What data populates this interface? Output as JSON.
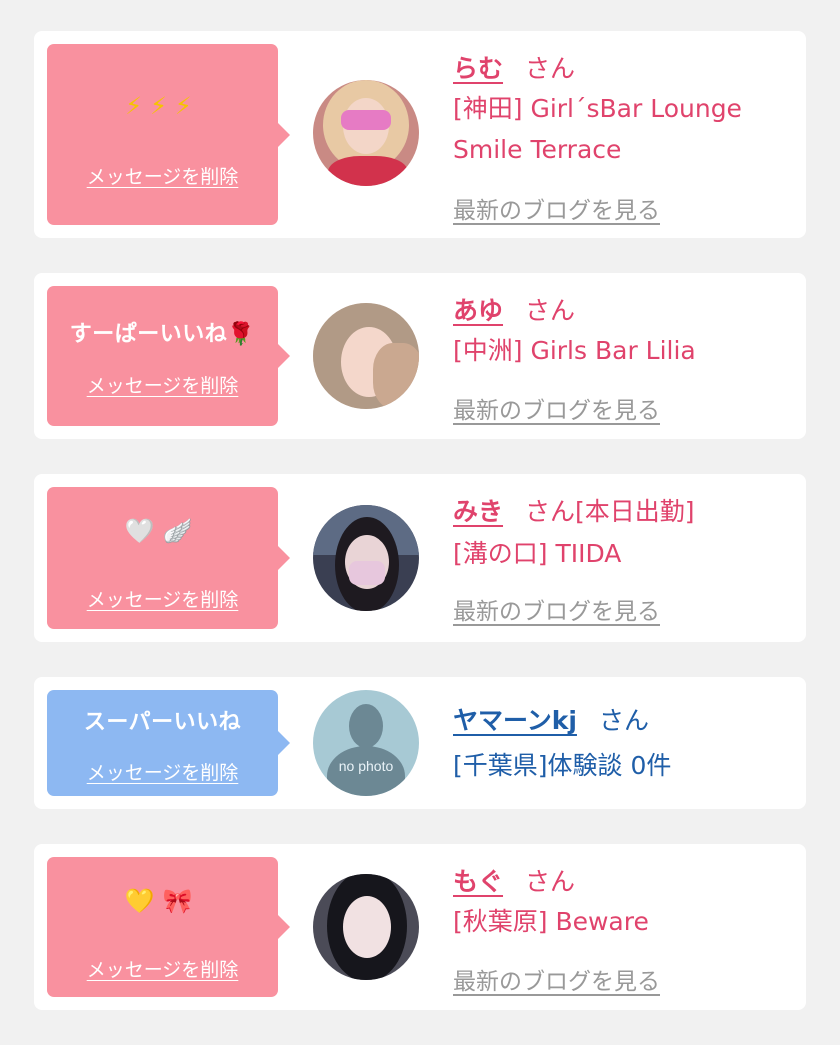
{
  "colors": {
    "background": "#f1f1f1",
    "card": "#ffffff",
    "bubble_pink": "#f9919f",
    "bubble_blue": "#8db8f2",
    "name_pink": "#e0436c",
    "name_blue": "#1f5ea8",
    "blog_link_gray": "#999999"
  },
  "messages": [
    {
      "bubble": {
        "text": "",
        "icons": [
          "⚡",
          "⚡",
          "⚡"
        ],
        "icon_names": [
          "lightning-icon",
          "lightning-icon",
          "lightning-icon"
        ],
        "delete_label": "メッセージを削除"
      },
      "name": "らむ",
      "suffix": "さん",
      "shop_line1": "[神田] Girl´sBar Lounge",
      "shop_line2": "Smile Terrace",
      "blog_link": "最新のブログを見る"
    },
    {
      "bubble": {
        "text": "すーぱーいいね",
        "icons": [
          "🌹"
        ],
        "icon_names": [
          "rose-icon"
        ],
        "delete_label": "メッセージを削除"
      },
      "name": "あゆ",
      "suffix": "さん",
      "shop_line1": "[中洲] Girls Bar Lilia",
      "blog_link": "最新のブログを見る"
    },
    {
      "bubble": {
        "text": "",
        "icons": [
          "🤍",
          "🪽"
        ],
        "icon_names": [
          "white-heart-icon",
          "wing-icon"
        ],
        "delete_label": "メッセージを削除"
      },
      "name": "みき",
      "suffix": "さん[本日出勤]",
      "shop_line1": "[溝の口] TIIDA",
      "blog_link": "最新のブログを見る"
    },
    {
      "bubble": {
        "text": "スーパーいいね",
        "icons": [],
        "delete_label": "メッセージを削除"
      },
      "name": "ヤマーンkj",
      "suffix": "さん",
      "shop_line1": "[千葉県]体験談 0件",
      "avatar_text": "no photo"
    },
    {
      "bubble": {
        "text": "",
        "icons": [
          "💛",
          "🎀"
        ],
        "icon_names": [
          "yellow-heart-icon",
          "ribbon-icon"
        ],
        "delete_label": "メッセージを削除"
      },
      "name": "もぐ",
      "suffix": "さん",
      "shop_line1": "[秋葉原] Beware",
      "blog_link": "最新のブログを見る"
    }
  ]
}
